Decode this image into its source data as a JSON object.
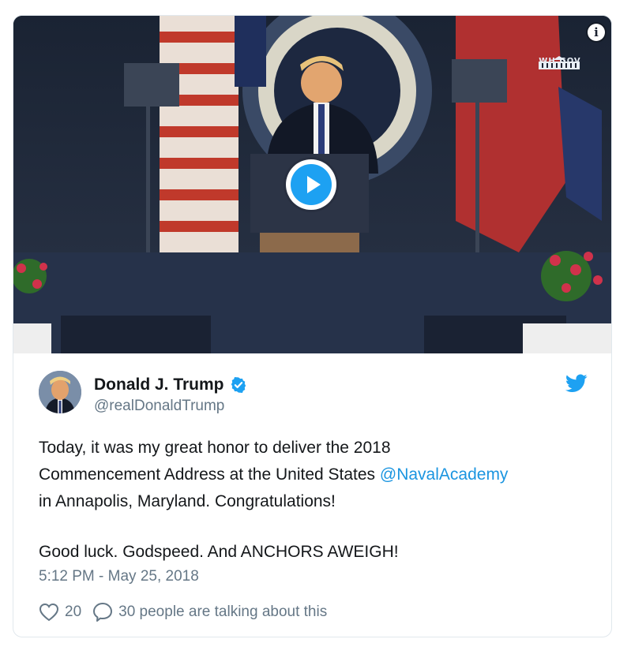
{
  "media": {
    "watermark_text": "WH.GOV",
    "info_icon": "i",
    "play_icon": "play-icon"
  },
  "author": {
    "name": "Donald J. Trump",
    "handle": "@realDonaldTrump",
    "verified": true,
    "platform_icon": "twitter-bird-icon"
  },
  "tweet": {
    "line1": "Today, it was my great honor to deliver the 2018",
    "line2_before": "Commencement Address at the United States ",
    "mention": "@NavalAcademy",
    "line3": "in Annapolis, Maryland. Congratulations!",
    "line4": "Good luck. Godspeed. And ANCHORS AWEIGH!",
    "timestamp": "5:12 PM - May 25, 2018"
  },
  "actions": {
    "likes": "20",
    "talking": "30 people are talking about this"
  },
  "colors": {
    "link": "#1b95e0",
    "secondary_text": "#657786",
    "border": "#e1e8ed",
    "verified": "#1da1f2"
  }
}
